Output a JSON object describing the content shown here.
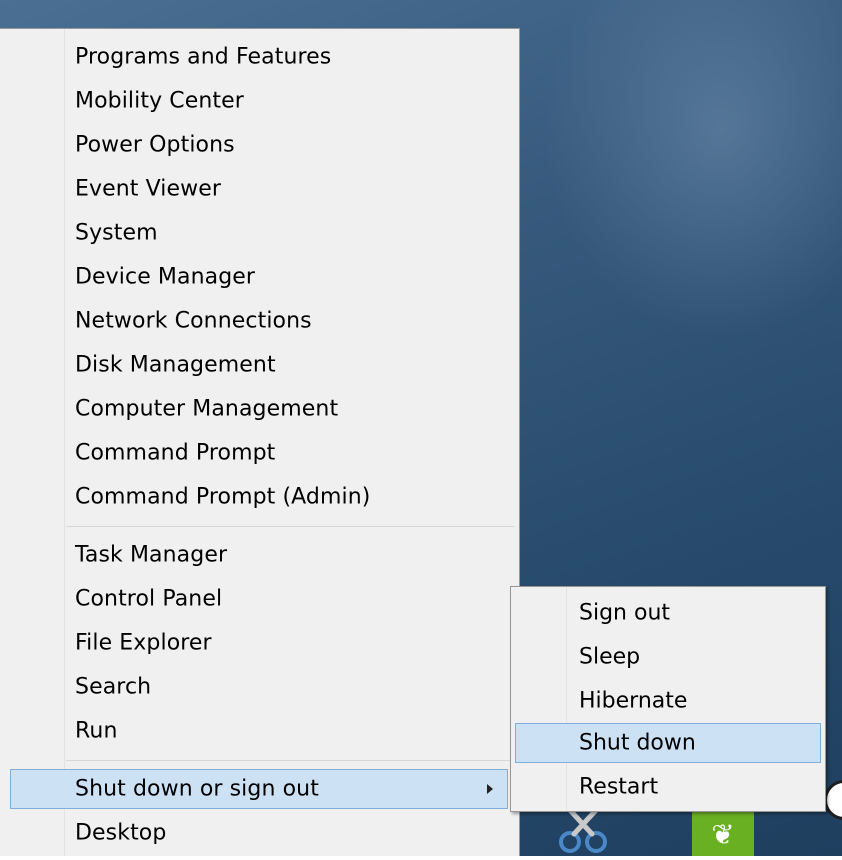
{
  "menu": {
    "items": [
      {
        "label": "Programs and Features",
        "top": 0
      },
      {
        "label": "Mobility Center"
      },
      {
        "label": "Power Options"
      },
      {
        "label": "Event Viewer"
      },
      {
        "label": "System"
      },
      {
        "label": "Device Manager"
      },
      {
        "label": "Network Connections"
      },
      {
        "label": "Disk Management"
      },
      {
        "label": "Computer Management"
      },
      {
        "label": "Command Prompt"
      },
      {
        "label": "Command Prompt (Admin)"
      },
      {
        "label": "Task Manager"
      },
      {
        "label": "Control Panel"
      },
      {
        "label": "File Explorer"
      },
      {
        "label": "Search"
      },
      {
        "label": "Run"
      },
      {
        "label": "Shut down or sign out"
      },
      {
        "label": "Desktop"
      }
    ]
  },
  "submenu": {
    "items": [
      {
        "label": "Sign out"
      },
      {
        "label": "Sleep"
      },
      {
        "label": "Hibernate"
      },
      {
        "label": "Shut down"
      },
      {
        "label": "Restart"
      }
    ]
  },
  "taskbar": {
    "icons": [
      "scissors-icon",
      "evernote-icon",
      "round-app-icon"
    ]
  },
  "colors": {
    "menu_bg": "#f0f0f0",
    "highlight_bg": "#cde1f5",
    "highlight_border": "#7faedb",
    "desktop": "#2f5477"
  }
}
